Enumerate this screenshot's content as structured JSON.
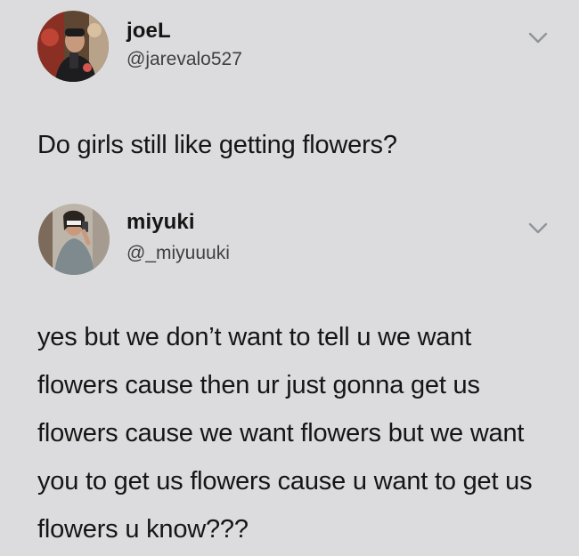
{
  "tweets": [
    {
      "author": {
        "display_name": "joeL",
        "handle": "@jarevalo527"
      },
      "icons": {
        "avatar": "avatar-photo",
        "menu": "chevron-down-icon"
      },
      "text": "Do girls still like getting flowers?"
    },
    {
      "author": {
        "display_name": "miyuki",
        "handle": "@_miyuuuki"
      },
      "icons": {
        "avatar": "avatar-photo",
        "menu": "chevron-down-icon"
      },
      "text": "yes but we don’t want to tell u we want flowers cause then ur just gonna get us flowers cause we want flowers but we want you to get us flowers cause u want to get us flowers u know???"
    }
  ],
  "colors": {
    "background": "#dcdcde",
    "text": "#151515",
    "handle": "#3f3f44",
    "chevron": "#8f949a"
  }
}
